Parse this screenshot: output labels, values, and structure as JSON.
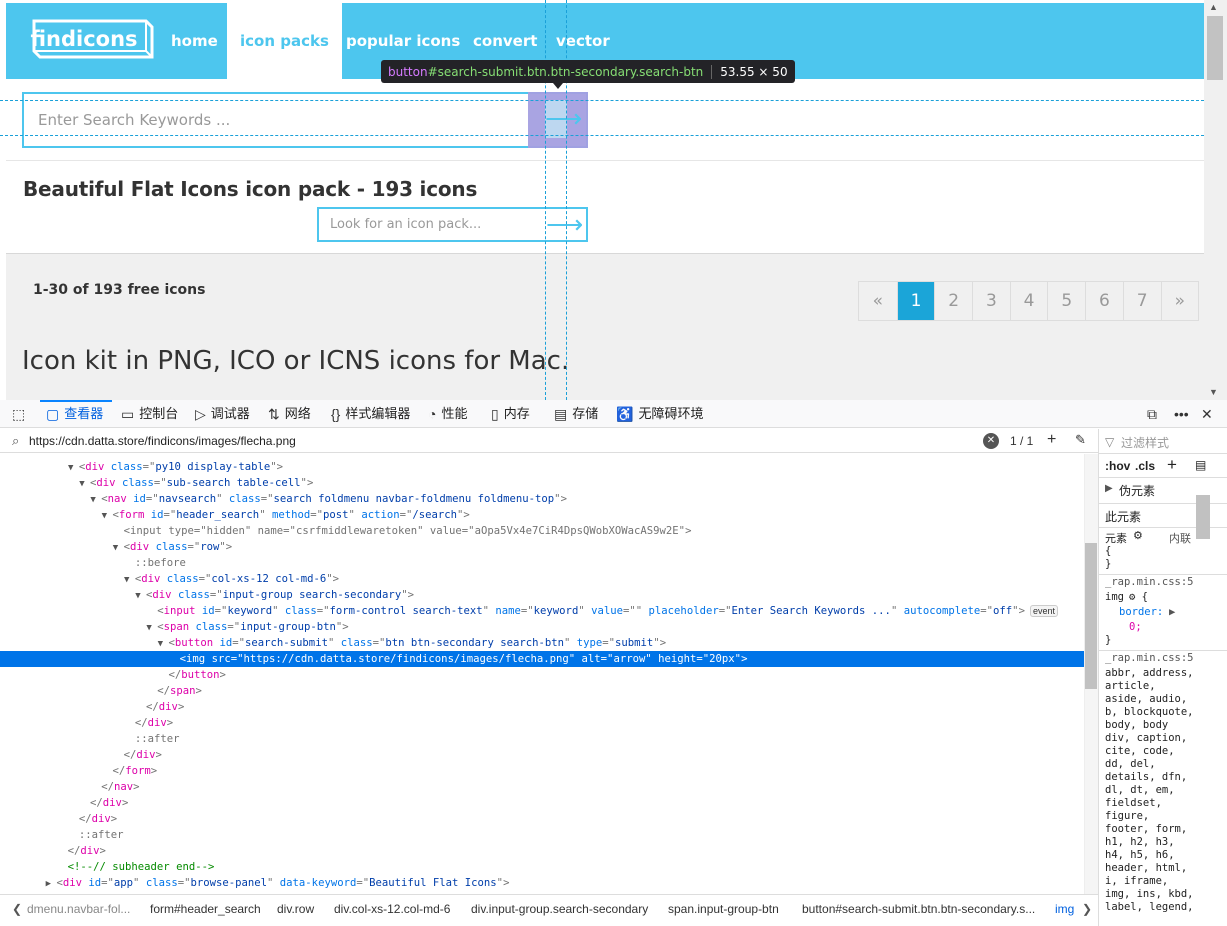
{
  "site": {
    "logo": "findicons",
    "nav": [
      "home",
      "icon packs",
      "popular icons",
      "convert",
      "vector"
    ],
    "search_placeholder": "Enter Search Keywords ...",
    "pack_title": "Beautiful Flat Icons icon pack - 193 icons",
    "pack_search_placeholder": "Look for an icon pack...",
    "count_label": "1-30 of 193 free icons",
    "pagination": [
      "«",
      "1",
      "2",
      "3",
      "4",
      "5",
      "6",
      "7",
      "»"
    ],
    "active_page": "1",
    "kit_title": "Icon kit in PNG, ICO or ICNS icons for Mac."
  },
  "tooltip": {
    "tag": "button",
    "selector": "#search-submit.btn.btn-secondary.search-btn",
    "size": "53.55 × 50"
  },
  "devtools": {
    "tabs": [
      {
        "label": "查看器",
        "icon": "inspector-icon"
      },
      {
        "label": "控制台",
        "icon": "console-icon"
      },
      {
        "label": "调试器",
        "icon": "debugger-icon"
      },
      {
        "label": "网络",
        "icon": "network-icon"
      },
      {
        "label": "样式编辑器",
        "icon": "style-editor-icon"
      },
      {
        "label": "性能",
        "icon": "performance-icon"
      },
      {
        "label": "内存",
        "icon": "memory-icon"
      },
      {
        "label": "存储",
        "icon": "storage-icon"
      },
      {
        "label": "无障碍环境",
        "icon": "accessibility-icon"
      }
    ],
    "search_url": "https://cdn.datta.store/findicons/images/flecha.png",
    "search_count": "1 / 1",
    "markup_lines": [
      {
        "indent": 5,
        "open": true,
        "tag": "div",
        "attrs": [
          [
            "class",
            "py10 display-table"
          ]
        ],
        "close": false
      },
      {
        "indent": 6,
        "open": true,
        "tag": "div",
        "attrs": [
          [
            "class",
            "sub-search table-cell"
          ]
        ],
        "close": false
      },
      {
        "indent": 7,
        "open": true,
        "tag": "nav",
        "attrs": [
          [
            "id",
            "navsearch"
          ],
          [
            "class",
            "search foldmenu navbar-foldmenu foldmenu-top"
          ]
        ],
        "close": false
      },
      {
        "indent": 8,
        "open": true,
        "tag": "form",
        "attrs": [
          [
            "id",
            "header_search"
          ],
          [
            "method",
            "post"
          ],
          [
            "action",
            "/search"
          ]
        ],
        "close": false
      },
      {
        "indent": 9,
        "open": null,
        "tag": "input",
        "attrs": [
          [
            "type",
            "hidden"
          ],
          [
            "name",
            "csrfmiddlewaretoken"
          ],
          [
            "value",
            "aOpa5Vx4e7CiR4DpsQWobXOWacAS9w2E"
          ]
        ],
        "close": false,
        "grey": true
      },
      {
        "indent": 9,
        "open": true,
        "tag": "div",
        "attrs": [
          [
            "class",
            "row"
          ]
        ],
        "close": false
      },
      {
        "indent": 10,
        "pseudo": "::before"
      },
      {
        "indent": 10,
        "open": true,
        "tag": "div",
        "attrs": [
          [
            "class",
            "col-xs-12 col-md-6"
          ]
        ],
        "close": false
      },
      {
        "indent": 11,
        "open": true,
        "tag": "div",
        "attrs": [
          [
            "class",
            "input-group search-secondary"
          ]
        ],
        "close": false
      },
      {
        "indent": 12,
        "open": null,
        "tag": "input",
        "attrs": [
          [
            "id",
            "keyword"
          ],
          [
            "class",
            "form-control search-text"
          ],
          [
            "name",
            "keyword"
          ],
          [
            "value",
            ""
          ],
          [
            "placeholder",
            "Enter Search Keywords ..."
          ],
          [
            "autocomplete",
            "off"
          ]
        ],
        "close": false,
        "event": "event"
      },
      {
        "indent": 12,
        "open": true,
        "tag": "span",
        "attrs": [
          [
            "class",
            "input-group-btn"
          ]
        ],
        "close": false
      },
      {
        "indent": 13,
        "open": true,
        "tag": "button",
        "attrs": [
          [
            "id",
            "search-submit"
          ],
          [
            "class",
            "btn btn-secondary search-btn"
          ],
          [
            "type",
            "submit"
          ]
        ],
        "close": false
      },
      {
        "indent": 14,
        "open": null,
        "tag": "img",
        "attrs": [
          [
            "src",
            "https://cdn.datta.store/findicons/images/flecha.png"
          ],
          [
            "alt",
            "arrow"
          ],
          [
            "height",
            "20px"
          ]
        ],
        "close": false,
        "selected": true
      },
      {
        "indent": 13,
        "closetag": "button"
      },
      {
        "indent": 12,
        "closetag": "span"
      },
      {
        "indent": 11,
        "closetag": "div"
      },
      {
        "indent": 10,
        "closetag": "div"
      },
      {
        "indent": 10,
        "pseudo": "::after"
      },
      {
        "indent": 9,
        "closetag": "div"
      },
      {
        "indent": 8,
        "closetag": "form"
      },
      {
        "indent": 7,
        "closetag": "nav"
      },
      {
        "indent": 6,
        "closetag": "div"
      },
      {
        "indent": 5,
        "closetag": "div"
      },
      {
        "indent": 5,
        "pseudo": "::after"
      },
      {
        "indent": 4,
        "closetag": "div"
      },
      {
        "indent": 4,
        "comment": "<!--// subheader end-->"
      },
      {
        "indent": 3,
        "open": false,
        "tag": "div",
        "attrs": [
          [
            "id",
            "app"
          ],
          [
            "class",
            "browse-panel"
          ],
          [
            "data-keyword",
            "Beautiful Flat Icons"
          ]
        ],
        "close": false
      }
    ],
    "breadcrumbs": [
      "dmenu.navbar-fol...",
      "form#header_search",
      "div.row",
      "div.col-xs-12.col-md-6",
      "div.input-group.search-secondary",
      "span.input-group-btn",
      "button#search-submit.btn.btn-secondary.s...",
      "img"
    ],
    "rules": {
      "filter_placeholder": "过滤样式",
      "hov": ":hov",
      "cls": ".cls",
      "pseudo_elements": "伪元素",
      "this_element": "此元素",
      "element_label": "元素",
      "inline_label": "内联",
      "open_brace": "{",
      "close_brace": "}",
      "src1": "_rap.min.css:5",
      "sel1": "img",
      "prop1": "border:",
      "val1": "0;",
      "src2": "_rap.min.css:5",
      "sel2_lines": [
        "abbr, address,",
        "article,",
        "aside, audio,",
        "b, blockquote,",
        "body, body",
        "div, caption,",
        "cite, code,",
        "dd, del,",
        "details, dfn,",
        "dl, dt, em,",
        "fieldset,",
        "figure,",
        "footer, form,",
        "h1, h2, h3,",
        "h4, h5, h6,",
        "header, html,",
        "i, iframe,",
        "img, ins, kbd,",
        "label, legend,"
      ]
    }
  }
}
